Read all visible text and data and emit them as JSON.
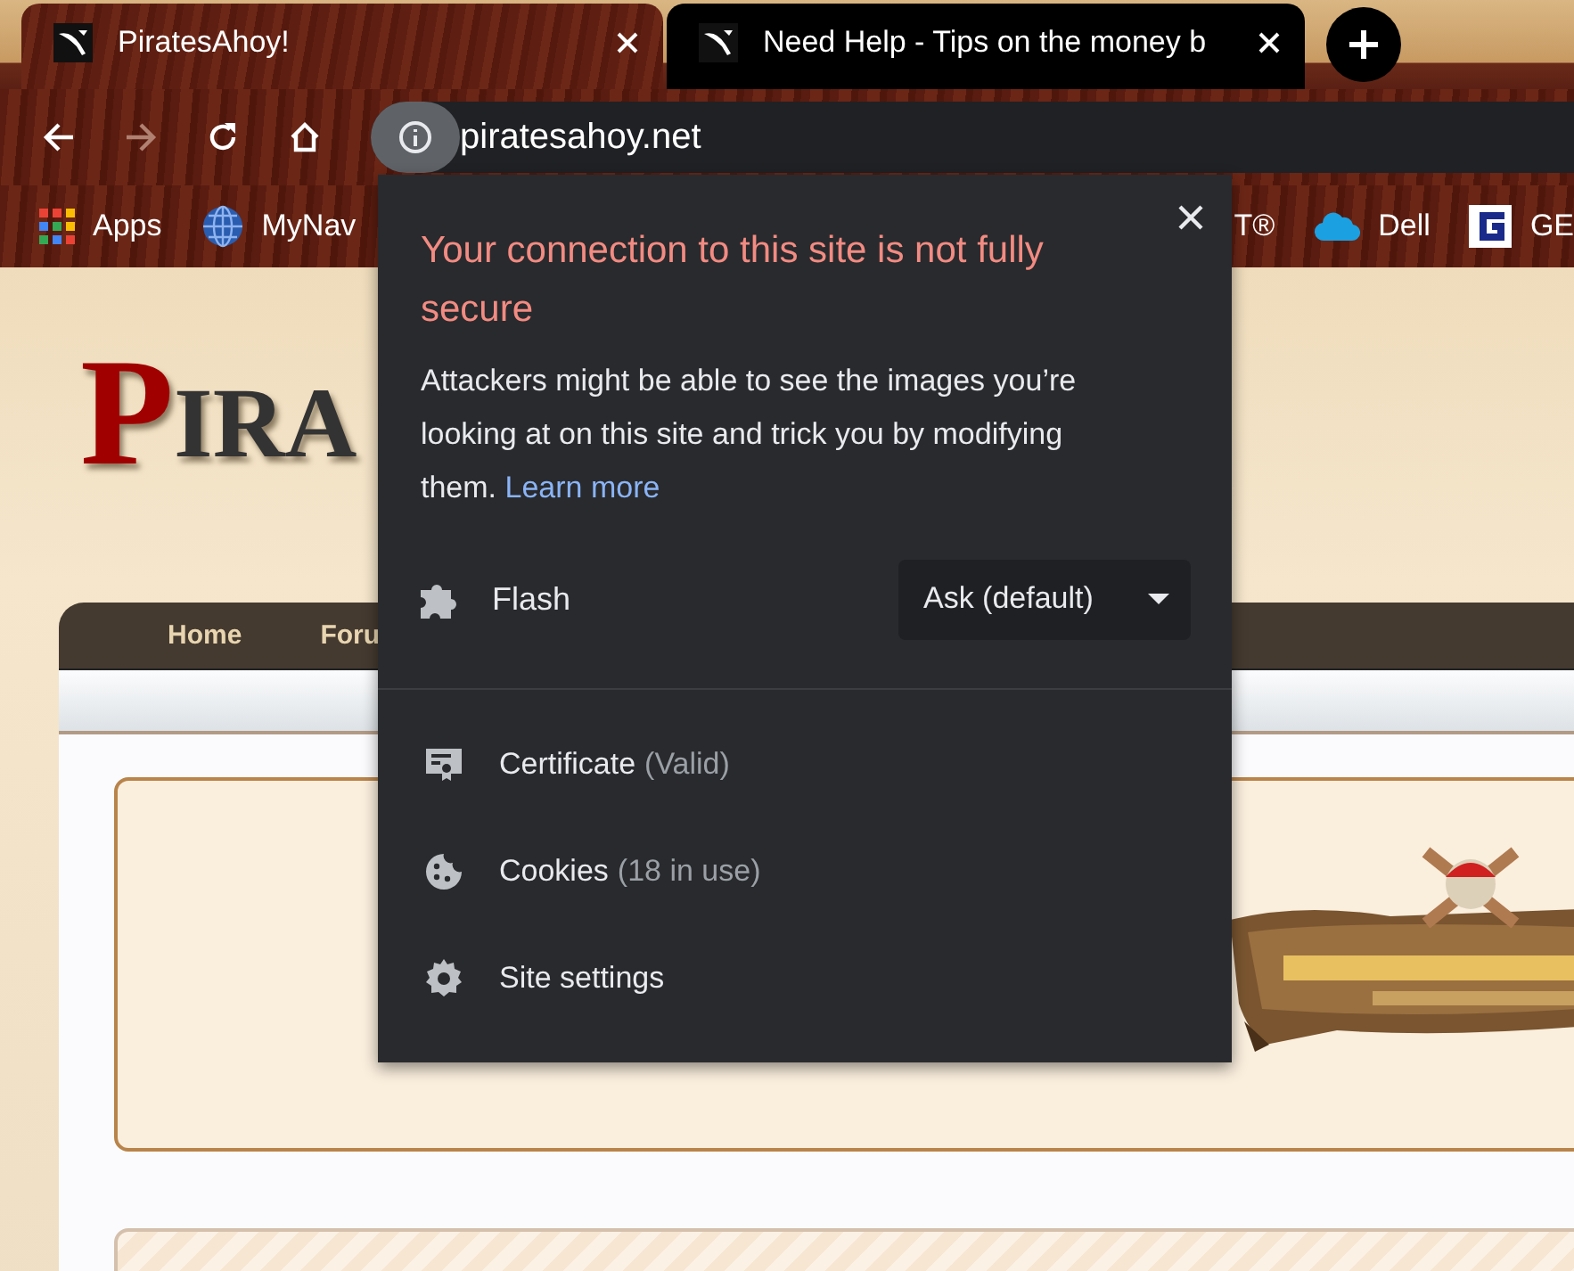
{
  "tabs": [
    {
      "title": "PiratesAhoy!",
      "selected": true
    },
    {
      "title": "Need Help - Tips on the money b",
      "selected": false
    }
  ],
  "toolbar": {
    "nav_buttons": [
      {
        "kind": "back",
        "disabled": false
      },
      {
        "kind": "forward",
        "disabled": true
      },
      {
        "kind": "reload",
        "disabled": false
      },
      {
        "kind": "home",
        "disabled": false
      }
    ],
    "url": "piratesahoy.net"
  },
  "bookmarks": [
    {
      "kind": "apps",
      "label": "Apps"
    },
    {
      "kind": "globe",
      "label": "MyNav"
    },
    {
      "kind": "text",
      "label": "T®"
    },
    {
      "kind": "cloud",
      "label": "Dell"
    },
    {
      "kind": "letter",
      "label": "GE"
    }
  ],
  "site": {
    "logo": "PIRA",
    "nav": [
      "Home",
      "Foru"
    ],
    "banner": {
      "kind": "picture"
    }
  },
  "site_info_popup": {
    "title": "Your connection to this site is not fully secure",
    "body": "Attackers might be able to see the images you’re looking at on this site and trick you by modifying them.",
    "link": "Learn more",
    "permission": {
      "label": "Flash",
      "value": "Ask (default)"
    },
    "items": [
      {
        "kind": "certificate",
        "label": "Certificate",
        "detail": "(Valid)"
      },
      {
        "kind": "cookies",
        "label": "Cookies",
        "detail": "(18 in use)"
      },
      {
        "kind": "settings",
        "label": "Site settings"
      }
    ]
  }
}
